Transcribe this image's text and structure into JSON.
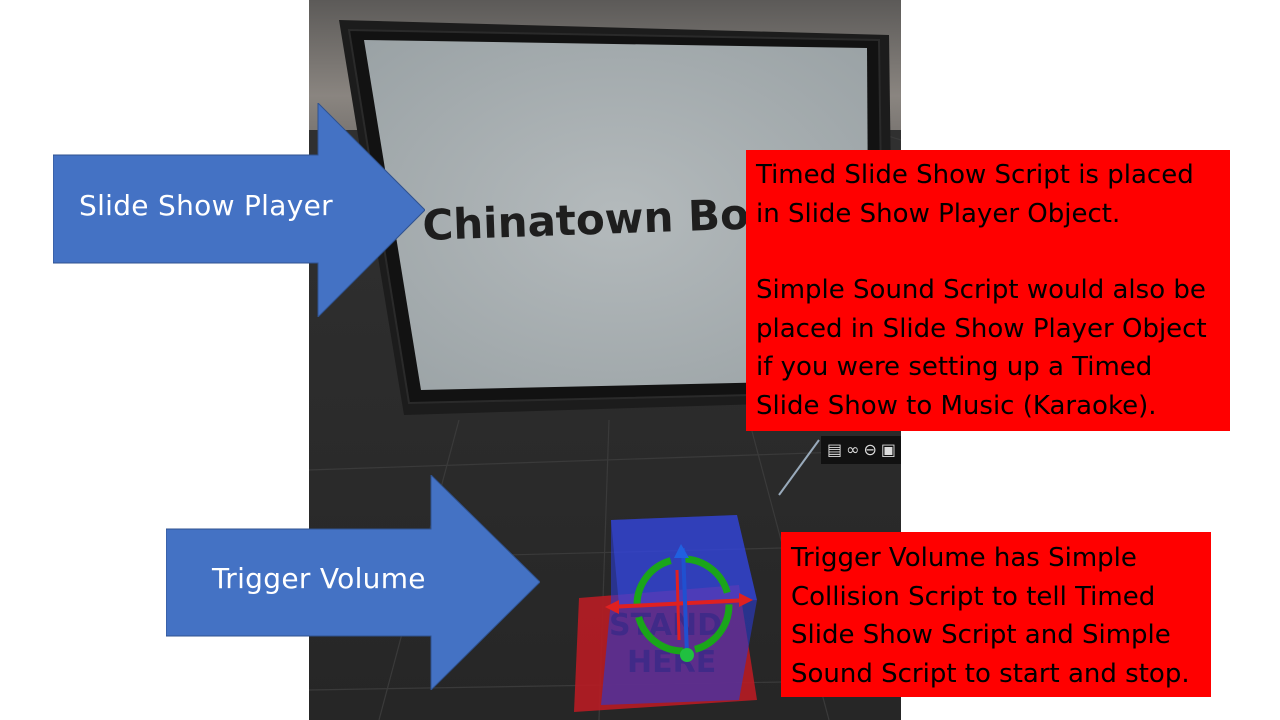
{
  "scene": {
    "screen_sign_text": "Chinatown Bo",
    "floor_sign_line1": "STAND",
    "floor_sign_line2": "HERE",
    "toolbar_icons": [
      "notes-icon",
      "link-icon",
      "minus-circle-icon",
      "lock-icon"
    ]
  },
  "arrows": {
    "slide_show_player": {
      "label": "Slide Show Player"
    },
    "trigger_volume": {
      "label": "Trigger Volume"
    }
  },
  "callouts": {
    "slide_show": {
      "paragraph1": "Timed Slide Show Script is placed in Slide Show Player Object.",
      "paragraph2": "Simple Sound Script would also be placed in Slide Show Player Object if you were setting up a Timed Slide Show to Music (Karaoke)."
    },
    "trigger": {
      "paragraph1": "Trigger Volume has Simple Collision Script to tell Timed Slide Show Script and Simple Sound Script to start and stop."
    }
  },
  "colors": {
    "arrow_fill": "#4472c4",
    "callout_fill": "#ff0000",
    "scene_floor": "#2b2b2b",
    "screen_surface": "#a9b0b3"
  }
}
